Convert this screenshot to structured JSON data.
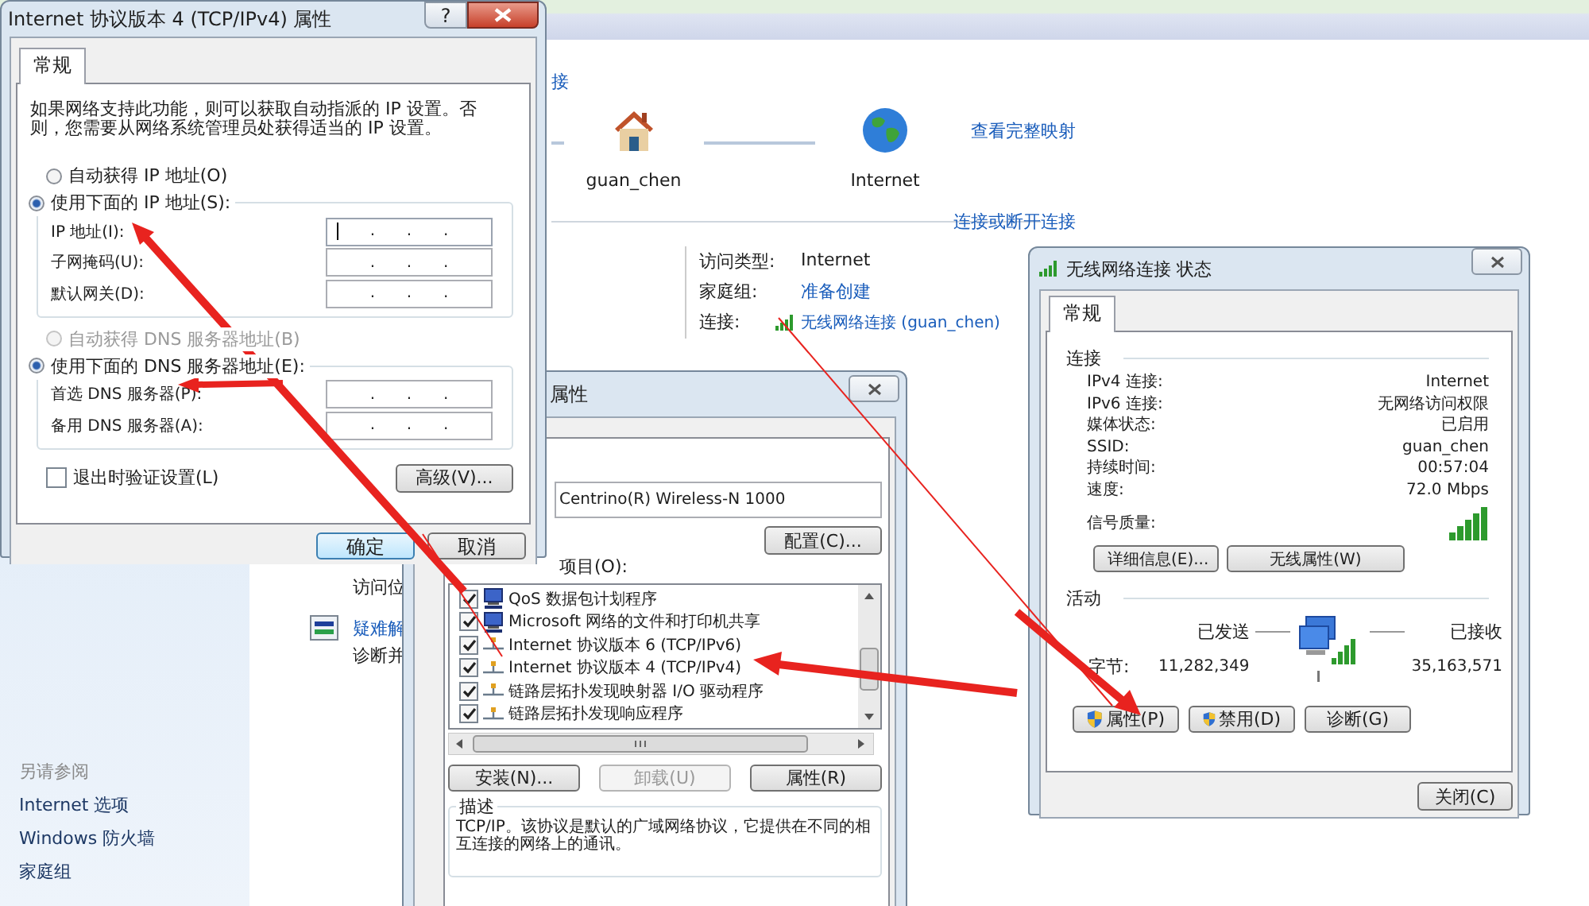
{
  "background_window": {
    "partial_link": "接",
    "nodes": [
      {
        "kind": "home",
        "label": "guan_chen"
      },
      {
        "kind": "internet",
        "label": "Internet"
      }
    ],
    "full_map_link": "查看完整映射",
    "connect_link": "连接或断开连接",
    "details": [
      {
        "label": "访问类型:",
        "value": "Internet",
        "kind": "text"
      },
      {
        "label": "家庭组:",
        "value": "准备创建",
        "kind": "link"
      },
      {
        "label": "连接:",
        "value": "无线网络连接 (guan_chen)",
        "kind": "wifi-link"
      }
    ],
    "tasks": [
      {
        "kind": "text",
        "text": "访问位"
      },
      {
        "kind": "link",
        "text": "疑难解"
      },
      {
        "kind": "text",
        "text": "诊断并"
      }
    ],
    "see_also": {
      "heading": "另请参阅",
      "links": [
        "Internet 选项",
        "Windows 防火墙",
        "家庭组"
      ]
    }
  },
  "ipv4_dialog": {
    "title": "Internet 协议版本 4 (TCP/IPv4) 属性",
    "help_button": "?",
    "tabs": [
      {
        "label": "常规",
        "selected": true
      }
    ],
    "intro": "如果网络支持此功能，则可以获取自动指派的 IP 设置。否则，您需要从网络系统管理员处获得适当的 IP 设置。",
    "octet_separator": ".",
    "groups": [
      {
        "auto": {
          "label": "自动获得 IP 地址(O)",
          "selected": false,
          "disabled": false
        },
        "manual": {
          "label": "使用下面的 IP 地址(S):",
          "selected": true
        },
        "fields": [
          {
            "label": "IP 地址(I):",
            "focused": true
          },
          {
            "label": "子网掩码(U):",
            "focused": false
          },
          {
            "label": "默认网关(D):",
            "focused": false
          }
        ]
      },
      {
        "auto": {
          "label": "自动获得 DNS 服务器地址(B)",
          "selected": false,
          "disabled": true
        },
        "manual": {
          "label": "使用下面的 DNS 服务器地址(E):",
          "selected": true
        },
        "fields": [
          {
            "label": "首选 DNS 服务器(P):",
            "focused": false
          },
          {
            "label": "备用 DNS 服务器(A):",
            "focused": false
          }
        ]
      }
    ],
    "validate_checkbox": {
      "label": "退出时验证设置(L)",
      "checked": false
    },
    "advanced_button": "高级(V)...",
    "buttons": [
      {
        "label": "确定",
        "default": true
      },
      {
        "label": "取消",
        "default": false
      }
    ]
  },
  "adapter_dialog": {
    "title": "属性",
    "adapter": "Centrino(R) Wireless-N 1000",
    "configure_button": "配置(C)...",
    "items_label": "项目(O):",
    "items": [
      {
        "kind": "computer",
        "label": "QoS 数据包计划程序",
        "checked": true
      },
      {
        "kind": "computer",
        "label": "Microsoft 网络的文件和打印机共享",
        "checked": true
      },
      {
        "kind": "protocol",
        "label": "Internet 协议版本 6 (TCP/IPv6)",
        "checked": true
      },
      {
        "kind": "protocol",
        "label": "Internet 协议版本 4 (TCP/IPv4)",
        "checked": true
      },
      {
        "kind": "protocol",
        "label": "链路层拓扑发现映射器 I/O 驱动程序",
        "checked": true
      },
      {
        "kind": "protocol",
        "label": "链路层拓扑发现响应程序",
        "checked": true
      }
    ],
    "buttons": [
      {
        "label": "安装(N)...",
        "disabled": false
      },
      {
        "label": "卸载(U)",
        "disabled": true
      },
      {
        "label": "属性(R)",
        "disabled": false
      }
    ],
    "description": {
      "heading": "描述",
      "text": "TCP/IP。该协议是默认的广域网络协议，它提供在不同的相互连接的网络上的通讯。"
    }
  },
  "status_dialog": {
    "title": "无线网络连接 状态",
    "tabs": [
      {
        "label": "常规",
        "selected": true
      }
    ],
    "connection": {
      "heading": "连接",
      "rows": [
        {
          "label": "IPv4 连接:",
          "value": "Internet"
        },
        {
          "label": "IPv6 连接:",
          "value": "无网络访问权限"
        },
        {
          "label": "媒体状态:",
          "value": "已启用"
        },
        {
          "label": "SSID:",
          "value": "guan_chen"
        },
        {
          "label": "持续时间:",
          "value": "00:57:04"
        },
        {
          "label": "速度:",
          "value": "72.0 Mbps"
        }
      ],
      "signal_label": "信号质量:",
      "buttons": [
        "详细信息(E)...",
        "无线属性(W)"
      ]
    },
    "activity": {
      "heading": "活动",
      "sent_label": "已发送",
      "received_label": "已接收",
      "bytes_label": "字节:",
      "sent": "11,282,349",
      "received": "35,163,571"
    },
    "buttons": [
      {
        "label": "属性(P)",
        "shield": true
      },
      {
        "label": "禁用(D)",
        "shield": true
      },
      {
        "label": "诊断(G)",
        "shield": false
      }
    ],
    "close_button": "关闭(C)"
  }
}
